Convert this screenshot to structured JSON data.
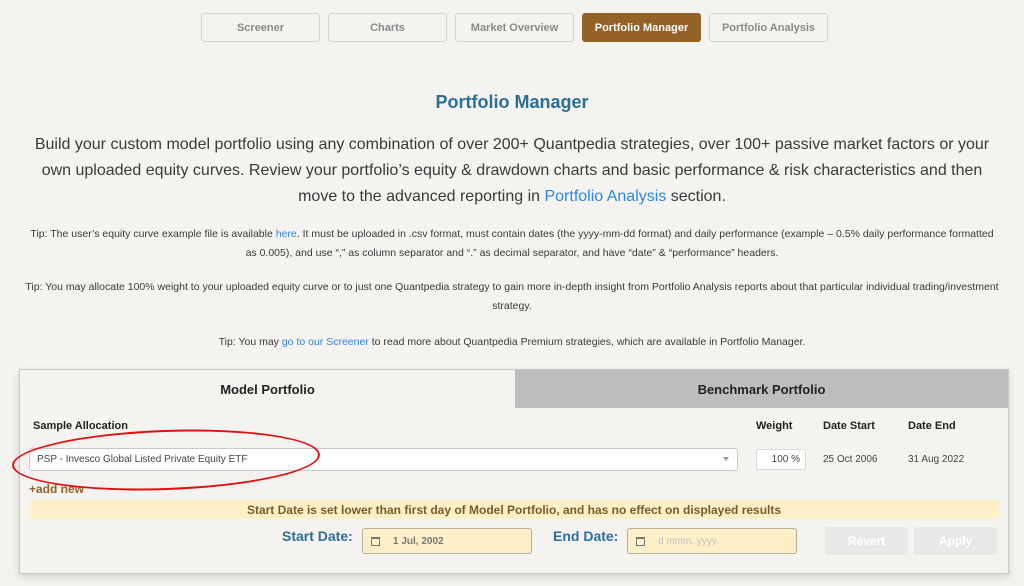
{
  "nav": {
    "items": [
      {
        "label": "Screener",
        "active": false
      },
      {
        "label": "Charts",
        "active": false
      },
      {
        "label": "Market Overview",
        "active": false
      },
      {
        "label": "Portfolio Manager",
        "active": true
      },
      {
        "label": "Portfolio Analysis",
        "active": false
      }
    ]
  },
  "colors": {
    "accent_brown": "#946127",
    "title_blue": "#2a6f97",
    "link_blue": "#2e86de",
    "warning_bg": "#fdf0c8",
    "annotation_red": "#e01010"
  },
  "header": {
    "title": "Portfolio Manager"
  },
  "intro": {
    "text_before_link": "Build your custom model portfolio using any combination of over 200+ Quantpedia strategies, over 100+ passive market factors or your own uploaded equity curves. Review your portfolio’s equity & drawdown charts and basic performance & risk characteristics and then move to the advanced reporting in ",
    "link": "Portfolio Analysis",
    "text_after_link": " section."
  },
  "tips": {
    "tip1_before_link": "Tip: The user’s equity curve example file is available ",
    "tip1_link": "here",
    "tip1_after_link": ".  It must be uploaded in .csv format, must contain dates (the yyyy-mm-dd format) and daily performance (example – 0.5% daily performance formatted as 0.005), and use “,” as column separator and “.” as decimal separator, and have “date” & “performance” headers.",
    "tip2": "Tip: You may allocate 100% weight to your uploaded equity curve or to just one Quantpedia strategy to gain more in-depth insight from Portfolio Analysis reports about that particular individual trading/investment strategy.",
    "tip3_before_link": "Tip: You may ",
    "tip3_link": "go to our Screener",
    "tip3_after_link": " to read more about Quantpedia Premium strategies, which are available in Portfolio Manager."
  },
  "panel": {
    "tabs": [
      {
        "label": "Model Portfolio",
        "active": true
      },
      {
        "label": "Benchmark Portfolio",
        "active": false
      }
    ],
    "columns": {
      "allocation": "Sample Allocation",
      "weight": "Weight",
      "date_start": "Date Start",
      "date_end": "Date End"
    },
    "rows": [
      {
        "allocation": "PSP - Invesco Global Listed Private Equity ETF",
        "weight": "100 %",
        "date_start": "25 Oct 2006",
        "date_end": "31 Aug 2022"
      }
    ],
    "add_new": "+add new",
    "warning": "Start Date is set lower than first day of Model Portfolio, and has no effect on displayed results",
    "start_date_label": "Start Date:",
    "start_date_value": "1 Jul, 2002",
    "end_date_label": "End Date:",
    "end_date_placeholder": "d mmm, yyyy",
    "revert_label": "Revert",
    "apply_label": "Apply"
  }
}
